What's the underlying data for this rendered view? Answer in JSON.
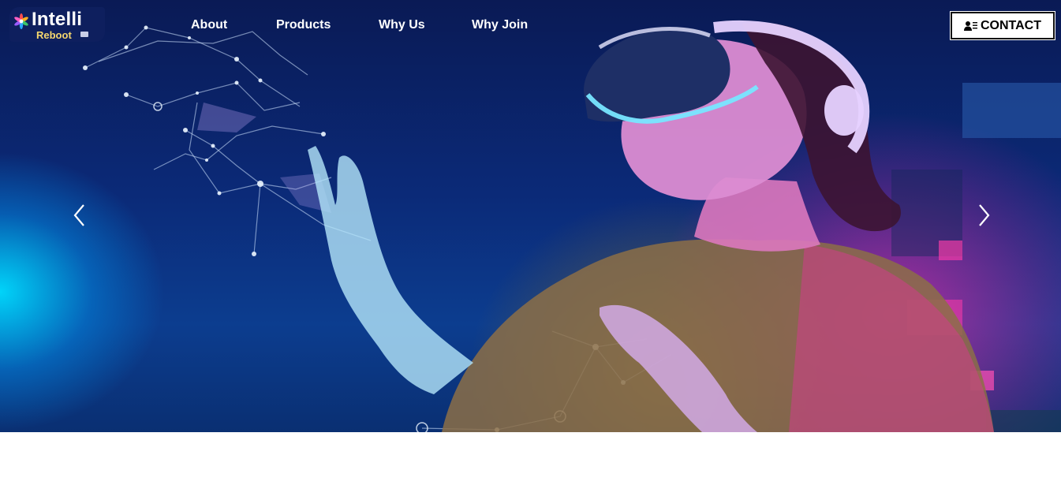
{
  "brand": {
    "name_line1": "Intelli",
    "name_line2": "Reboot"
  },
  "nav": {
    "items": [
      {
        "label": "About"
      },
      {
        "label": "Products"
      },
      {
        "label": "Why Us"
      },
      {
        "label": "Why Join"
      }
    ]
  },
  "contact": {
    "label": "CONTACT",
    "icon": "user-icon"
  },
  "carousel": {
    "prev_icon": "chevron-left-icon",
    "next_icon": "chevron-right-icon"
  },
  "colors": {
    "nav_text": "#ffffff",
    "logo_bg": "#0e1f5e",
    "logo_accent": "#f5d76e",
    "hero_base": "#0b2a78",
    "cyan_glow": "#00dcff",
    "magenta_glow": "#ff28aa"
  }
}
